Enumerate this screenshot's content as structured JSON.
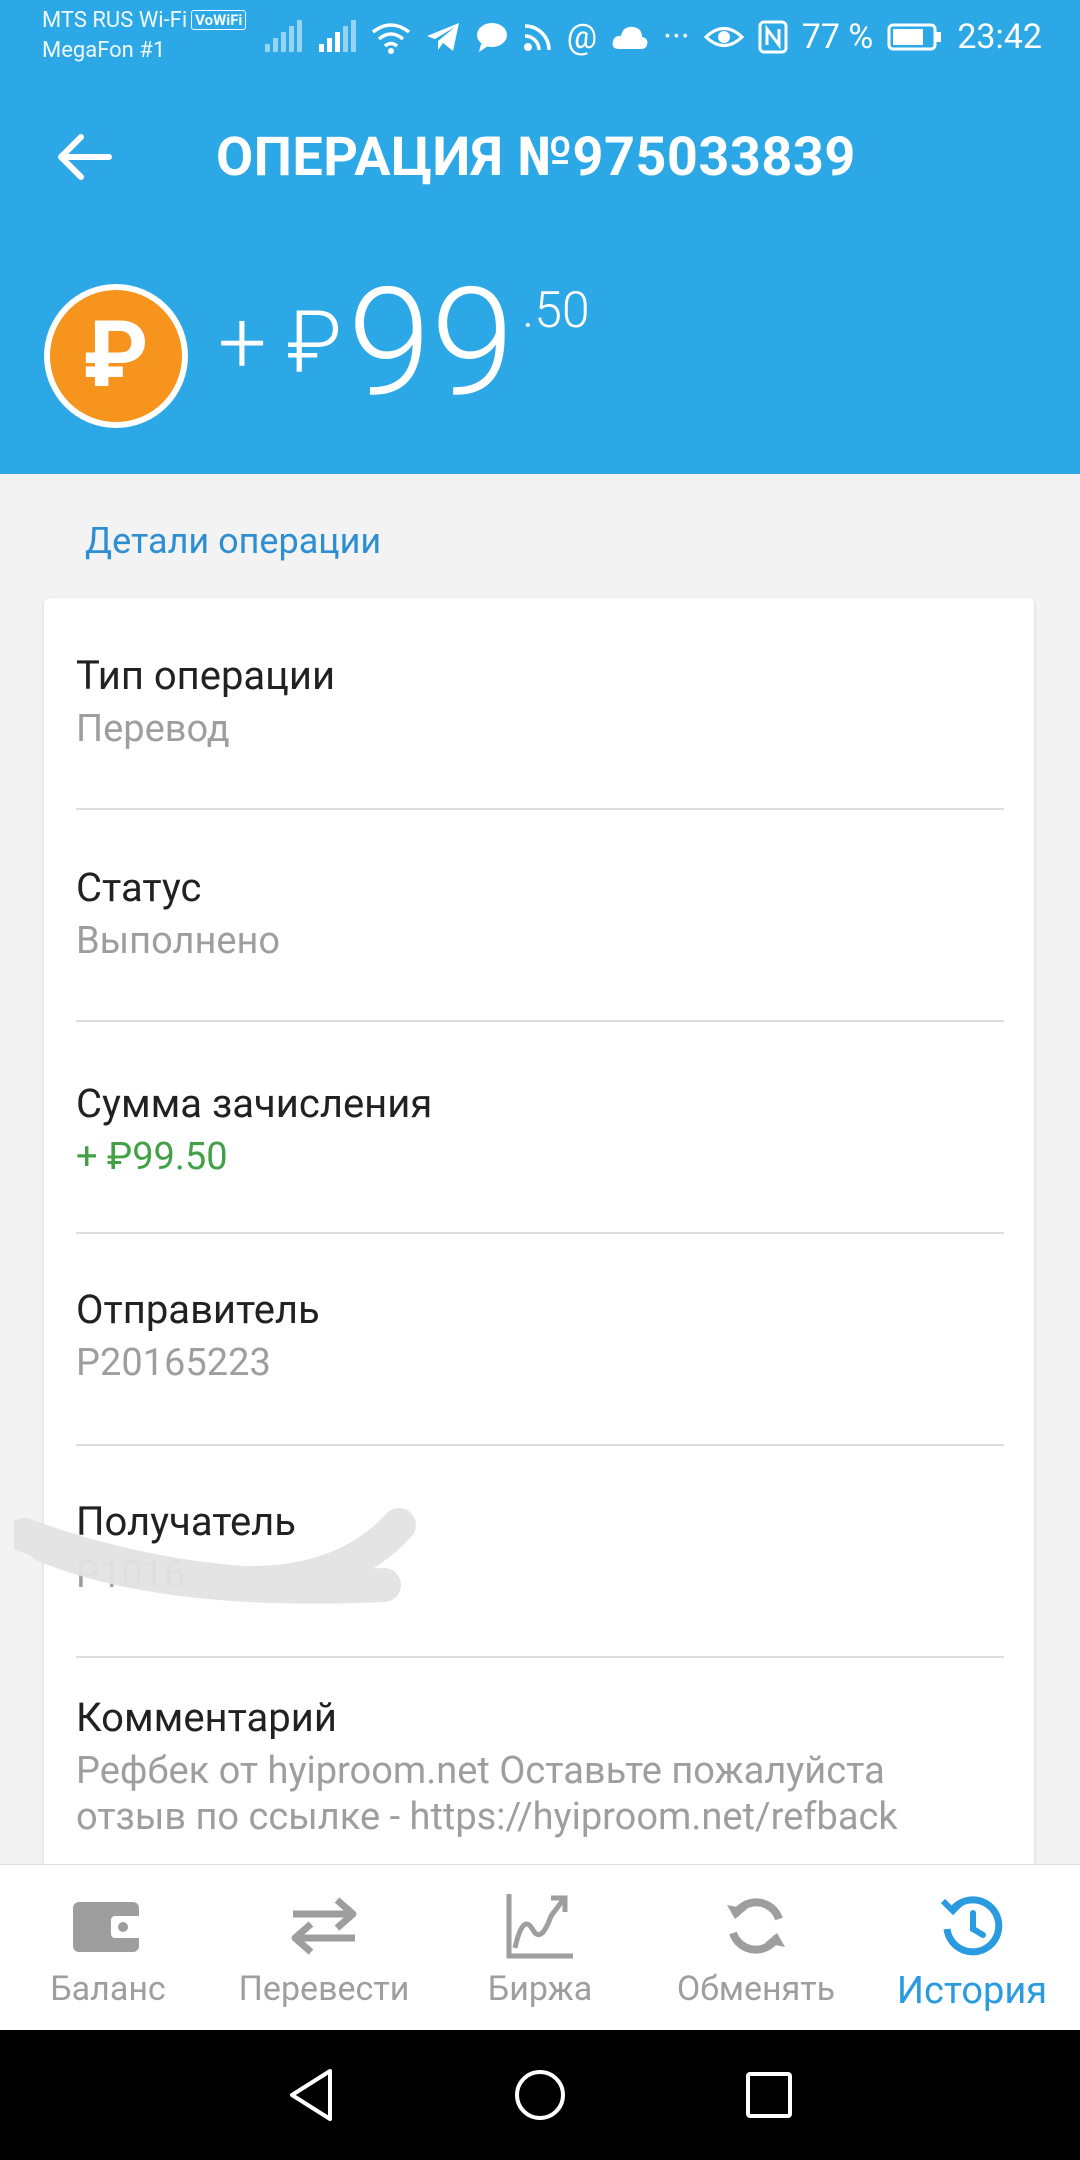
{
  "status_bar": {
    "carrier1": "MTS RUS Wi-Fi",
    "vowifi": "VoWiFi",
    "carrier2": "MegaFon #1",
    "battery": "77 %",
    "time": "23:42"
  },
  "appbar": {
    "title": "ОПЕРАЦИЯ №975033839"
  },
  "amount": {
    "sign": "+",
    "currency": "₽",
    "main": "99",
    "fraction": ".50",
    "coin_symbol": "₽"
  },
  "section_label": "Детали операции",
  "details": [
    {
      "label": "Тип операции",
      "value": "Перевод"
    },
    {
      "label": "Статус",
      "value": "Выполнено"
    },
    {
      "label": "Сумма зачисления",
      "value": "+ ₽99.50"
    },
    {
      "label": "Отправитель",
      "value": "P20165223"
    },
    {
      "label": "Получатель",
      "value": "P1016"
    },
    {
      "label": "Комментарий",
      "value_line1": "Рефбек от hyiproom.net  Оставьте пожалуйста",
      "value_line2": "отзыв по ссылке - https://hyiproom.net/refback"
    }
  ],
  "bottom_nav": [
    {
      "label": "Баланс",
      "icon": "wallet-icon"
    },
    {
      "label": "Перевести",
      "icon": "transfer-arrows-icon"
    },
    {
      "label": "Биржа",
      "icon": "chart-icon"
    },
    {
      "label": "Обменять",
      "icon": "exchange-refresh-icon"
    },
    {
      "label": "История",
      "icon": "history-clock-icon",
      "active": true
    }
  ],
  "colors": {
    "primary": "#2da8e6",
    "accent_green": "#43a047",
    "coin_orange": "#f7941d",
    "active_nav": "#2b9be0"
  }
}
